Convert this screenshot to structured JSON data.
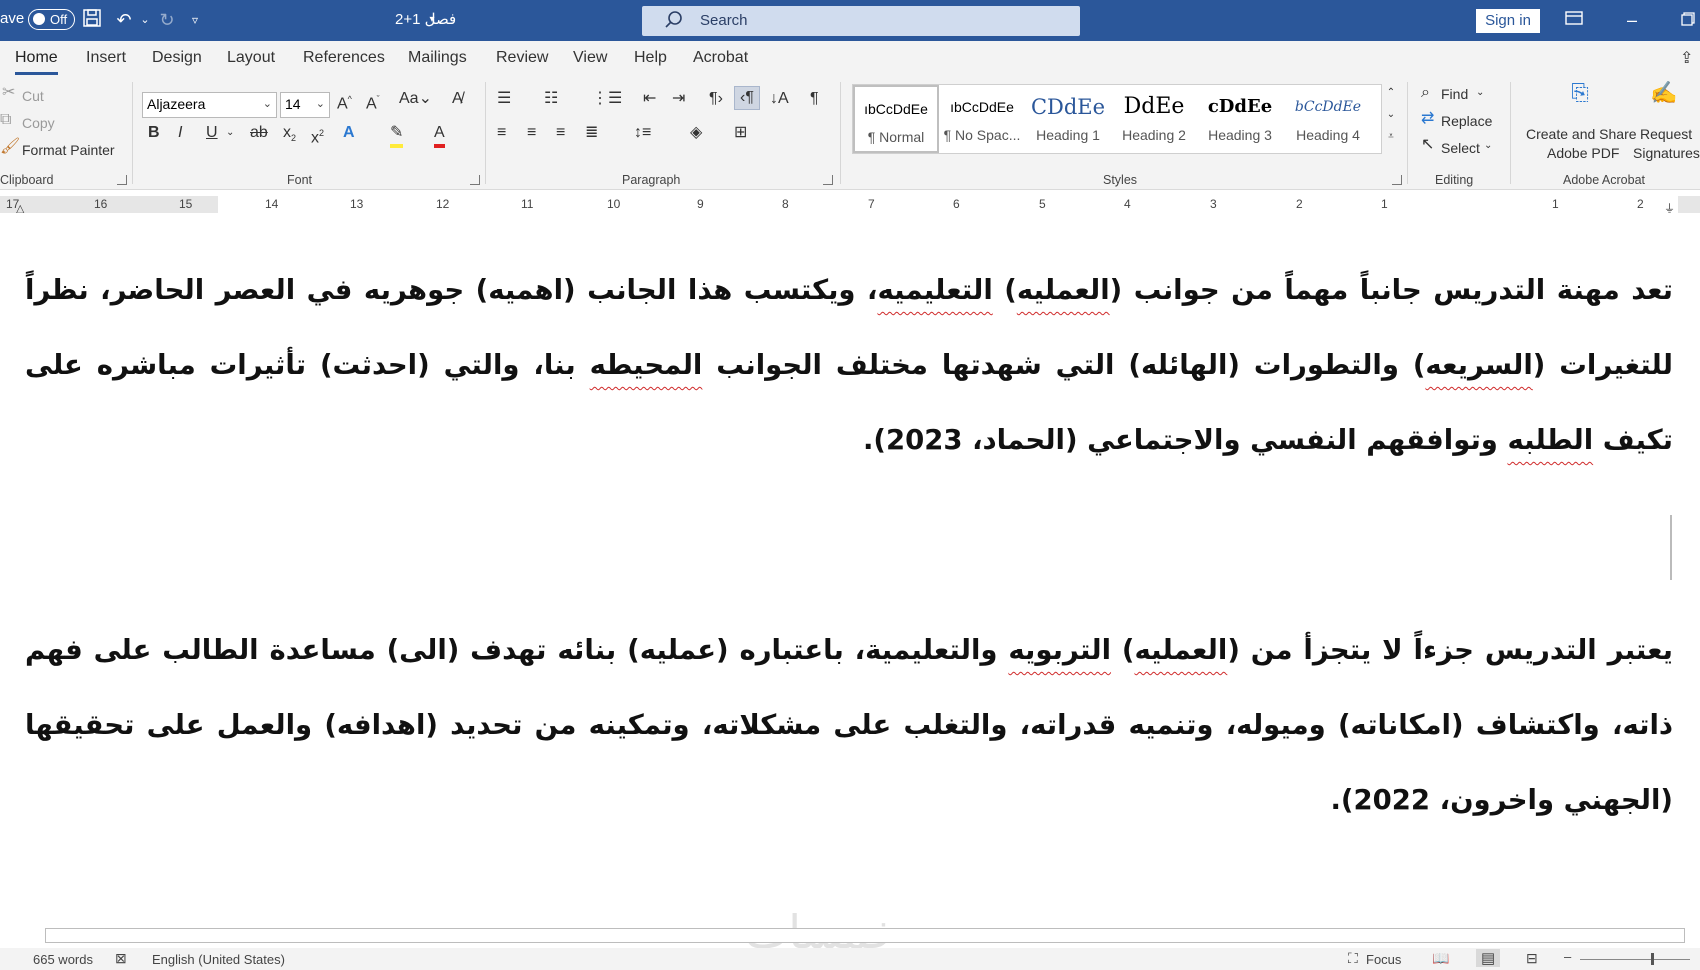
{
  "titlebar": {
    "autosave_label": "ave",
    "autosave_state": "Off",
    "doc_title": "فصل 1+2",
    "search_placeholder": "Search",
    "signin_label": "Sign in"
  },
  "tabs": [
    "Home",
    "Insert",
    "Design",
    "Layout",
    "References",
    "Mailings",
    "Review",
    "View",
    "Help",
    "Acrobat"
  ],
  "clipboard": {
    "cut": "Cut",
    "copy": "Copy",
    "format_painter": "Format Painter",
    "group": "Clipboard"
  },
  "font": {
    "name": "Aljazeera",
    "size": "14",
    "group": "Font"
  },
  "paragraph": {
    "group": "Paragraph"
  },
  "styles": {
    "group": "Styles",
    "items": [
      {
        "sample": "ıbCcDdEe",
        "name": "¶ Normal"
      },
      {
        "sample": "ıbCcDdEe",
        "name": "¶ No Spac..."
      },
      {
        "sample": "CDdEe",
        "name": "Heading 1"
      },
      {
        "sample": "DdEe",
        "name": "Heading 2"
      },
      {
        "sample": "cDdEe",
        "name": "Heading 3"
      },
      {
        "sample": "bCcDdEe",
        "name": "Heading 4"
      }
    ]
  },
  "editing": {
    "find": "Find",
    "replace": "Replace",
    "select": "Select",
    "group": "Editing"
  },
  "acrobat": {
    "create_line1": "Create and Share",
    "create_line2": "Adobe PDF",
    "request_line1": "Request",
    "request_line2": "Signatures",
    "group": "Adobe Acrobat"
  },
  "ruler_numbers": [
    "17",
    "16",
    "15",
    "14",
    "13",
    "12",
    "11",
    "10",
    "9",
    "8",
    "7",
    "6",
    "5",
    "4",
    "3",
    "2",
    "1",
    "1",
    "2"
  ],
  "document": {
    "p1": {
      "s1": "تعد مهنة التدريس جانباً مهماً من جوانب (",
      "w1": "العمليه",
      "s2": ") ",
      "w2": "التعليميه",
      "s3": "، ويكتسب هذا الجانب (اهميه) جوهريه في العصر الحاضر، نظراً للتغيرات (",
      "w3": "السريعه",
      "s4": ") والتطورات (الهائله) التي شهدتها مختلف الجوانب ",
      "w4": "المحيطه",
      "s5": " بنا، والتي (احدثت) تأثيرات مباشره على تكيف ",
      "w5": "الطلبه",
      "s6": " وتوافقهم النفسي والاجتماعي (الحماد، 2023)."
    },
    "p2": {
      "s1": "يعتبر التدريس جزءاً لا يتجزأ من (",
      "w1": "العمليه",
      "s2": ") ",
      "w2": "التربويه",
      "s3": " والتعليمية، باعتباره (عمليه) بنائه تهدف (الى) مساعدة الطالب على فهم ذاته، واكتشاف (امكاناته) وميوله، وتنميه قدراته، والتغلب على مشكلاته، وتمكينه من تحديد (اهدافه) والعمل على تحقيقها (الجهني واخرون، 2022)."
    },
    "watermark": "خمسات"
  },
  "statusbar": {
    "words": "665 words",
    "language": "English (United States)",
    "focus": "Focus"
  },
  "colors": {
    "title_bar": "#2b579a",
    "ribbon": "#f3f3f3",
    "spell_squiggle": "#d02a2a"
  }
}
